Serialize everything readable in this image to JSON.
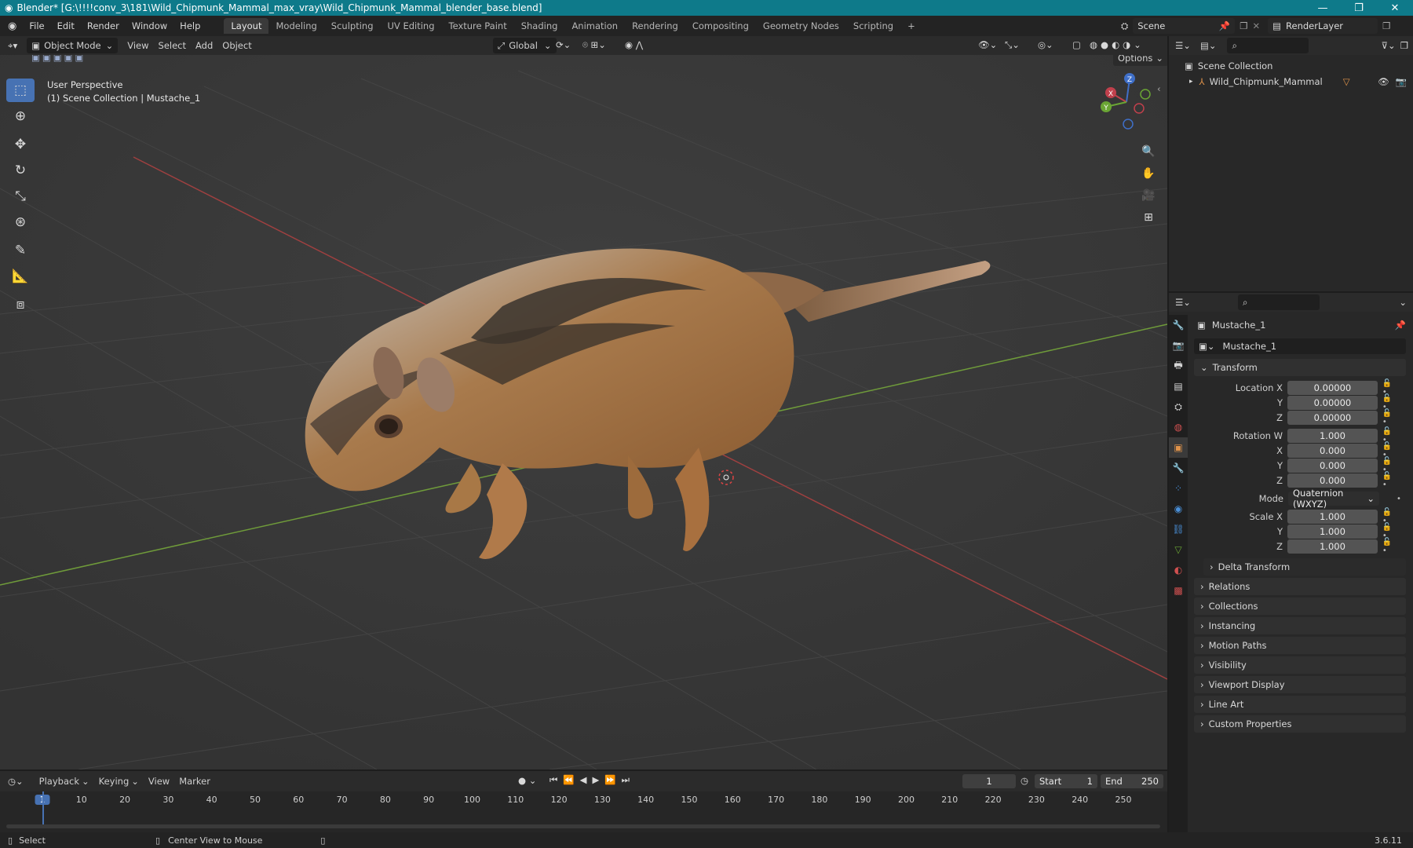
{
  "titlebar": {
    "app_icon": "blender-logo-icon",
    "title": "Blender* [G:\\!!!!conv_3\\181\\Wild_Chipmunk_Mammal_max_vray\\Wild_Chipmunk_Mammal_blender_base.blend]",
    "controls": [
      "minimize-icon",
      "restore-icon",
      "close-icon"
    ]
  },
  "menubar": {
    "menus": [
      "File",
      "Edit",
      "Render",
      "Window",
      "Help"
    ],
    "workspaces": [
      "Layout",
      "Modeling",
      "Sculpting",
      "UV Editing",
      "Texture Paint",
      "Shading",
      "Animation",
      "Rendering",
      "Compositing",
      "Geometry Nodes",
      "Scripting"
    ],
    "active_workspace": "Layout",
    "add_workspace": "+",
    "scene": "Scene",
    "render_layer": "RenderLayer"
  },
  "viewport_header": {
    "mode": "Object Mode",
    "menus": [
      "View",
      "Select",
      "Add",
      "Object"
    ],
    "orientation": "Global",
    "options": "Options"
  },
  "viewport": {
    "overlay_line1": "User Perspective",
    "overlay_line2": "(1) Scene Collection | Mustache_1",
    "gizmo": {
      "x": "X",
      "y": "Y",
      "z": "Z"
    },
    "colors": {
      "x_axis": "#a04040",
      "y_axis": "#6f9b3a",
      "bg": "#3b3b3b",
      "active_tool": "#4772b3"
    }
  },
  "outliner": {
    "root": "Scene Collection",
    "items": [
      {
        "label": "Wild_Chipmunk_Mammal"
      }
    ]
  },
  "properties": {
    "object_name": "Mustache_1",
    "data_name": "Mustache_1",
    "transform": {
      "title": "Transform",
      "location_label": "Location X",
      "location": [
        "0.00000",
        "0.00000",
        "0.00000"
      ],
      "rotation_label": "Rotation W",
      "rotation": [
        "1.000",
        "0.000",
        "0.000",
        "0.000"
      ],
      "mode_label": "Mode",
      "mode": "Quaternion (WXYZ)",
      "scale_label": "Scale X",
      "scale": [
        "1.000",
        "1.000",
        "1.000"
      ],
      "y": "Y",
      "z": "Z",
      "x": "X"
    },
    "sections": [
      "Delta Transform",
      "Relations",
      "Collections",
      "Instancing",
      "Motion Paths",
      "Visibility",
      "Viewport Display",
      "Line Art",
      "Custom Properties"
    ]
  },
  "timeline": {
    "menus": [
      "Playback",
      "Keying",
      "View",
      "Marker"
    ],
    "current_frame": "1",
    "start_label": "Start",
    "start": "1",
    "end_label": "End",
    "end": "250",
    "ticks": [
      "1",
      "10",
      "20",
      "30",
      "40",
      "50",
      "60",
      "70",
      "80",
      "90",
      "100",
      "110",
      "120",
      "130",
      "140",
      "150",
      "160",
      "170",
      "180",
      "190",
      "200",
      "210",
      "220",
      "230",
      "240",
      "250"
    ]
  },
  "statusbar": {
    "select": "Select",
    "center": "Center View to Mouse",
    "version": "3.6.11"
  }
}
